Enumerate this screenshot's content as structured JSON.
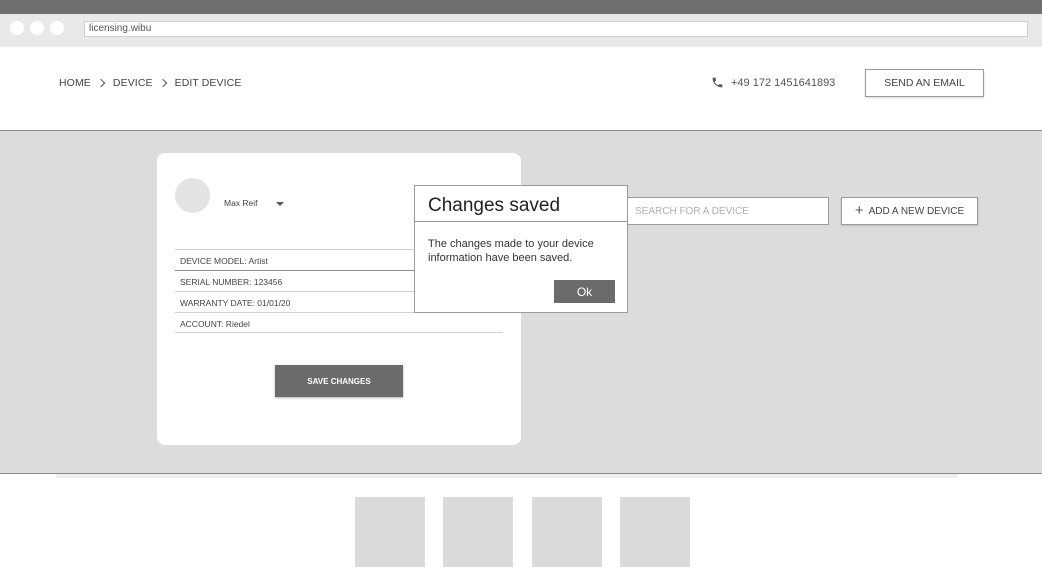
{
  "browser": {
    "url": "licensing.wibu"
  },
  "header": {
    "breadcrumbs": [
      "HOME",
      "DEVICE",
      "EDIT DEVICE"
    ],
    "phone": "+49 172 1451641893",
    "send_email_label": "SEND AN EMAIL"
  },
  "card": {
    "user_name": "Max Reif",
    "fields": [
      "DEVICE MODEL: Artist",
      "SERIAL NUMBER: 123456",
      "WARRANTY DATE: 01/01/20",
      "ACCOUNT: Riedel"
    ],
    "save_label": "SAVE CHANGES"
  },
  "toolbar": {
    "search_placeholder": "SEARCH FOR A DEVICE",
    "add_label": "ADD A NEW DEVICE"
  },
  "modal": {
    "title": "Changes saved",
    "message": "The changes made to your device information have been saved.",
    "ok_label": "Ok"
  },
  "colors": {
    "chrome_bar": "#6f6f6f",
    "main_background": "#dcdcdc",
    "dark_button": "#6b6b6b"
  },
  "icons": {
    "phone": "phone-icon",
    "plus": "plus-icon",
    "chevron": "chevron-right-icon",
    "dropdown": "caret-down-icon"
  }
}
